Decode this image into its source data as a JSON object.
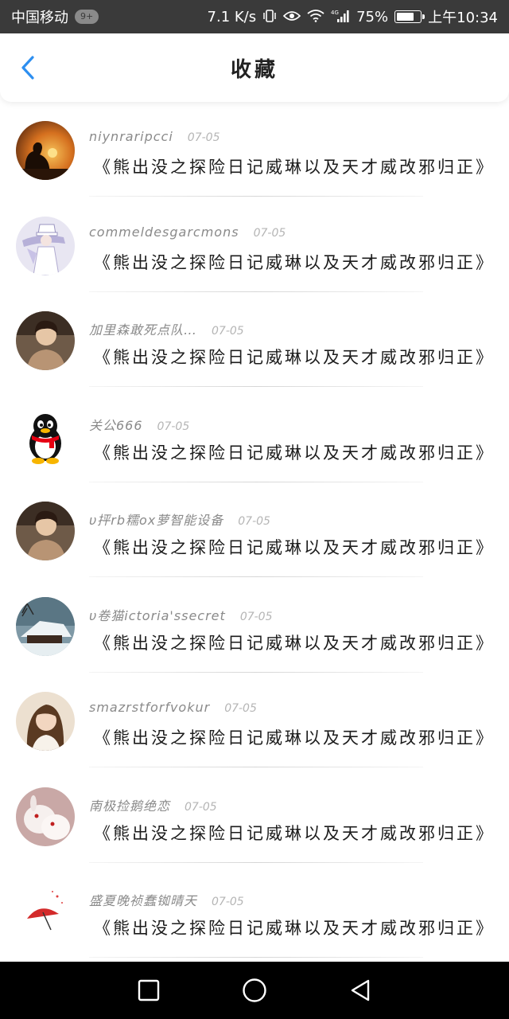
{
  "status_bar": {
    "carrier": "中国移动",
    "badge": "9+",
    "speed": "7.1 K/s",
    "network": "4G",
    "battery": "75%",
    "battery_level": 0.75,
    "time": "上午10:34"
  },
  "header": {
    "title": "收藏",
    "accent_color": "#2d8ff0"
  },
  "items": [
    {
      "name": "niynraripcci",
      "date": "07-05",
      "title": "《熊出没之探险日记威琳以及天才威改邪归正》",
      "avatar": "sunset-silhouette"
    },
    {
      "name": "commeldesgarcmons",
      "date": "07-05",
      "title": "《熊出没之探险日记威琳以及天才威改邪归正》",
      "avatar": "anime-character"
    },
    {
      "name": "加里森敢死点队…",
      "date": "07-05",
      "title": "《熊出没之探险日记威琳以及天才威改邪归正》",
      "avatar": "person-photo"
    },
    {
      "name": "关公666",
      "date": "07-05",
      "title": "《熊出没之探险日记威琳以及天才威改邪归正》",
      "avatar": "qq-penguin"
    },
    {
      "name": "υ抨rb糯ox萝智能设备",
      "date": "07-05",
      "title": "《熊出没之探险日记威琳以及天才威改邪归正》",
      "avatar": "person-photo"
    },
    {
      "name": "υ卷猫ictoria'ssecret",
      "date": "07-05",
      "title": "《熊出没之探险日记威琳以及天才威改邪归正》",
      "avatar": "snow-house"
    },
    {
      "name": "smazrstforfvokur",
      "date": "07-05",
      "title": "《熊出没之探险日记威琳以及天才威改邪归正》",
      "avatar": "girl-photo"
    },
    {
      "name": "南极捡鹅绝恋",
      "date": "07-05",
      "title": "《熊出没之探险日记威琳以及天才威改邪归正》",
      "avatar": "white-rabbits"
    },
    {
      "name": "盛夏晚祯蠢铷晴天",
      "date": "07-05",
      "title": "《熊出没之探险日记威琳以及天才威改邪归正》",
      "avatar": "red-umbrella-drawing"
    }
  ],
  "nav_bar": {
    "buttons": [
      "recent-apps",
      "home",
      "back"
    ]
  }
}
